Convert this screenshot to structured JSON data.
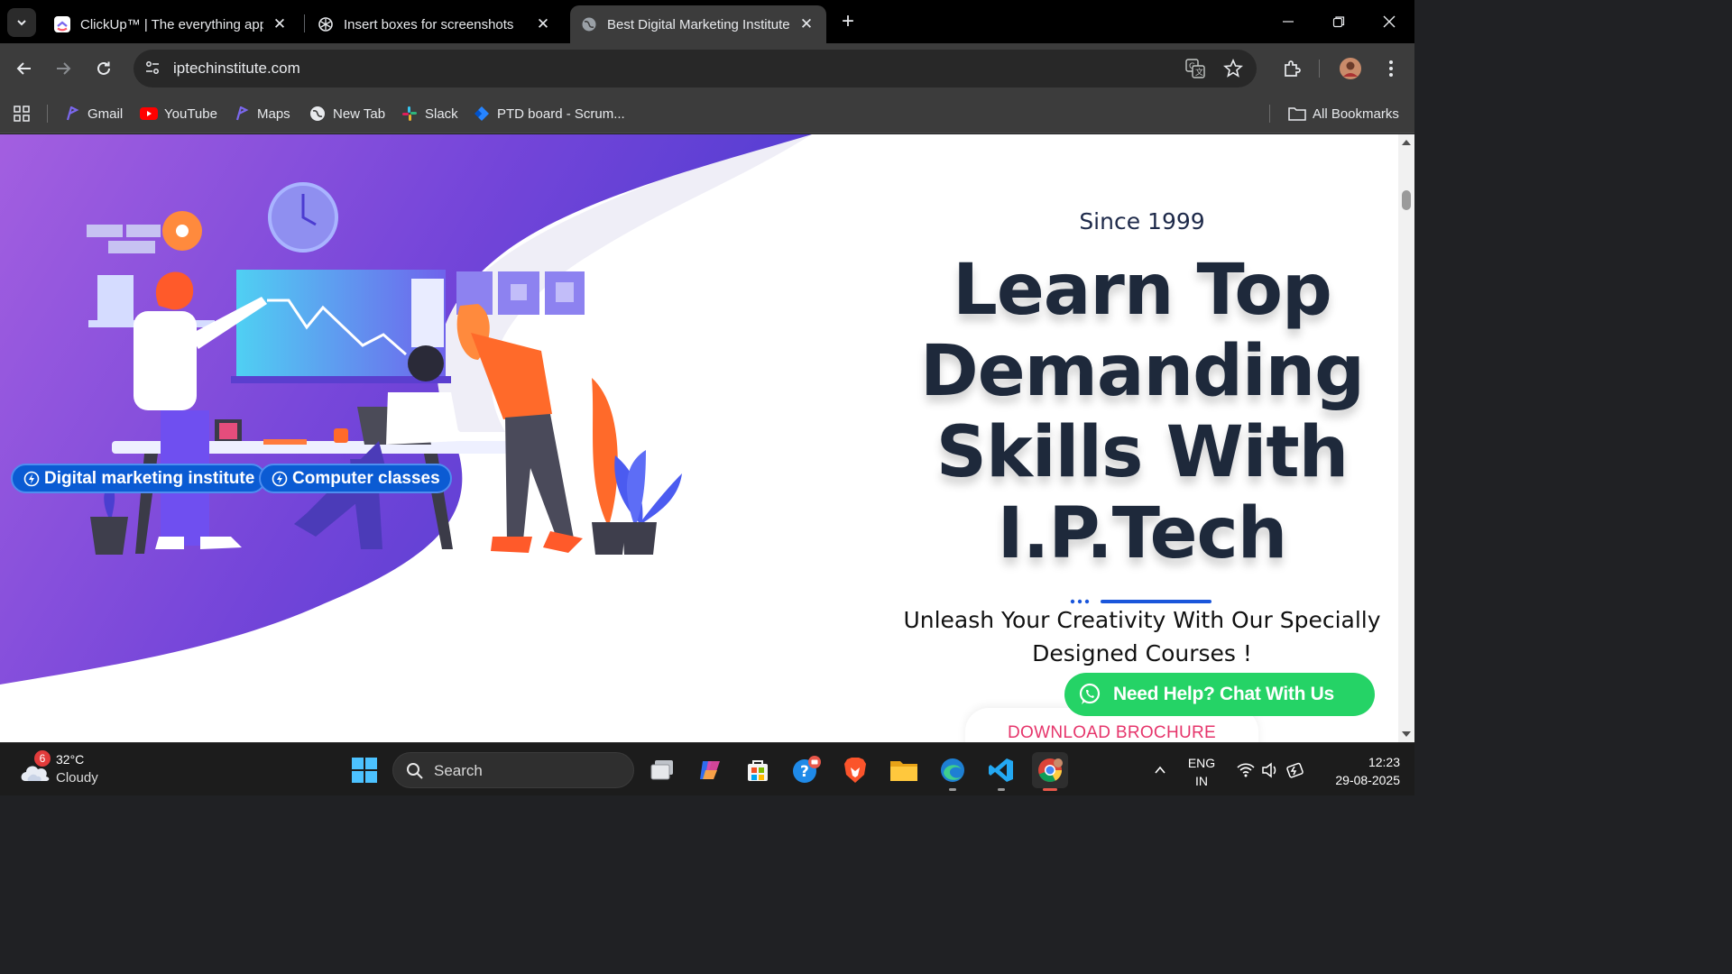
{
  "browser": {
    "tabs": [
      {
        "title": "ClickUp™ | The everything app f",
        "active": false
      },
      {
        "title": "Insert boxes for screenshots",
        "active": false
      },
      {
        "title": "Best Digital Marketing Institute",
        "active": true
      }
    ],
    "url": "iptechinstitute.com",
    "bookmarks": [
      "Gmail",
      "YouTube",
      "Maps",
      "New Tab",
      "Slack",
      "PTD board - Scrum...",
      "All Bookmarks"
    ]
  },
  "hero": {
    "since": "Since 1999",
    "headline_lines": [
      "Learn Top",
      "Demanding",
      "Skills With",
      "I.P.Tech"
    ],
    "subheading_lines": [
      "Unleash Your Creativity With Our Specially",
      "Designed Courses !"
    ],
    "chips": [
      "Digital marketing institute",
      "Computer classes"
    ],
    "brochure_label": "DOWNLOAD BROCHURE",
    "whatsapp_label": "Need Help? Chat With Us"
  },
  "colors": {
    "purple_dark": "#5b3fd1",
    "purple_light": "#9a5de8",
    "headline": "#1e293b",
    "chip_blue": "#0b5bd3",
    "whatsapp_green": "#25d366",
    "brochure_pink": "#e6356b"
  },
  "taskbar": {
    "weather_temp": "32°C",
    "weather_desc": "Cloudy",
    "weather_badge": "6",
    "search_placeholder": "Search",
    "lang_1": "ENG",
    "lang_2": "IN",
    "time": "12:23",
    "date": "29-08-2025"
  }
}
